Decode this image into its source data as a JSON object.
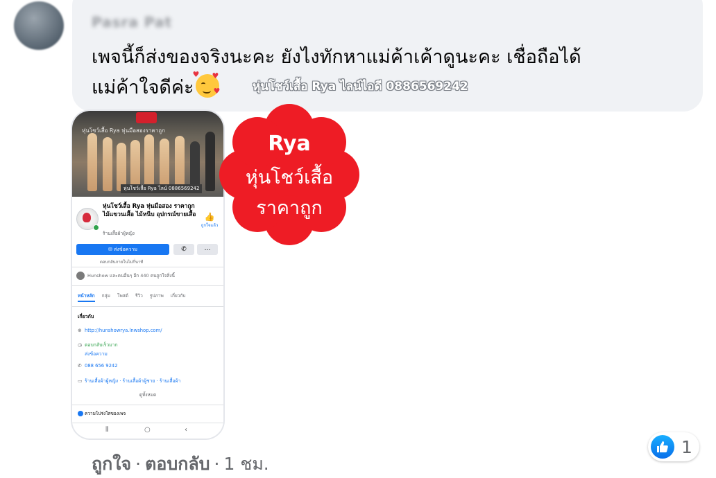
{
  "comment": {
    "author": "Pasra Pat",
    "line1": "เพจนี้ก็ส่งของจริงนะคะ ยังไงทักหาแม่ค้าเค้าดูนะคะ เชื่อถือได้",
    "line2": "แม่ค้าใจดีค่ะ",
    "emoji": "smiling-face-with-hearts-icon",
    "watermark": "หุ่นโชว์เสื้อ Rya ไลน์ไอดี 0886569242"
  },
  "screenshot": {
    "search_text": "หุ่นโชว์เสื้อ Rya หุ่นมือสองราคาถูก",
    "cover_tag": "หุ่นโชว์เสื้อ Rya ไลน์ 0886569242",
    "page_name": "หุ่นโชว์เสื้อ Rya หุ่นมือสอง ราคาถูก ไม้แขวนเสื้อ ไม้หนีบ อุปกรณ์ขายเสื้อ",
    "page_category": "ร้านเสื้อผ้าผู้หญิง",
    "like_label": "ถูกใจแล้ว",
    "message_button": "ส่งข้อความ",
    "call_icon": "phone-icon",
    "more_icon": "more-icon",
    "reply_note": "ตอบกลับภายในไม่กี่นาที",
    "friends_text": "Hunshow และคนอื่นๆ อีก 440 คนถูกใจสิ่งนี้",
    "tabs": [
      "หน้าหลัก",
      "กลุ่ม",
      "โพสต์",
      "รีวิว",
      "รูปภาพ",
      "เกี่ยวกับ"
    ],
    "info_title": "เกี่ยวกับ",
    "website": "http://hunshowrya.lnwshop.com/",
    "responds": "ตอบกลับเร็วมาก",
    "send_message": "ส่งข้อความ",
    "phone": "088 656 9242",
    "categories": "ร้านเสื้อผ้าผู้หญิง · ร้านเสื้อผ้าผู้ชาย · ร้านเสื้อผ้า",
    "see_all": "ดูทั้งหมด",
    "transparency": "ความโปร่งใสของเพจ"
  },
  "badge": {
    "line1": "Rya",
    "line2": "หุ่นโชว์เสื้อ",
    "line3": "ราคาถูก",
    "color": "#ee1c25"
  },
  "actions": {
    "like": "ถูกใจ",
    "reply": "ตอบกลับ",
    "time": "1 ชม.",
    "reaction_count": "1",
    "reaction_icon": "like-thumb-icon",
    "reaction_color": "#1877f2"
  }
}
